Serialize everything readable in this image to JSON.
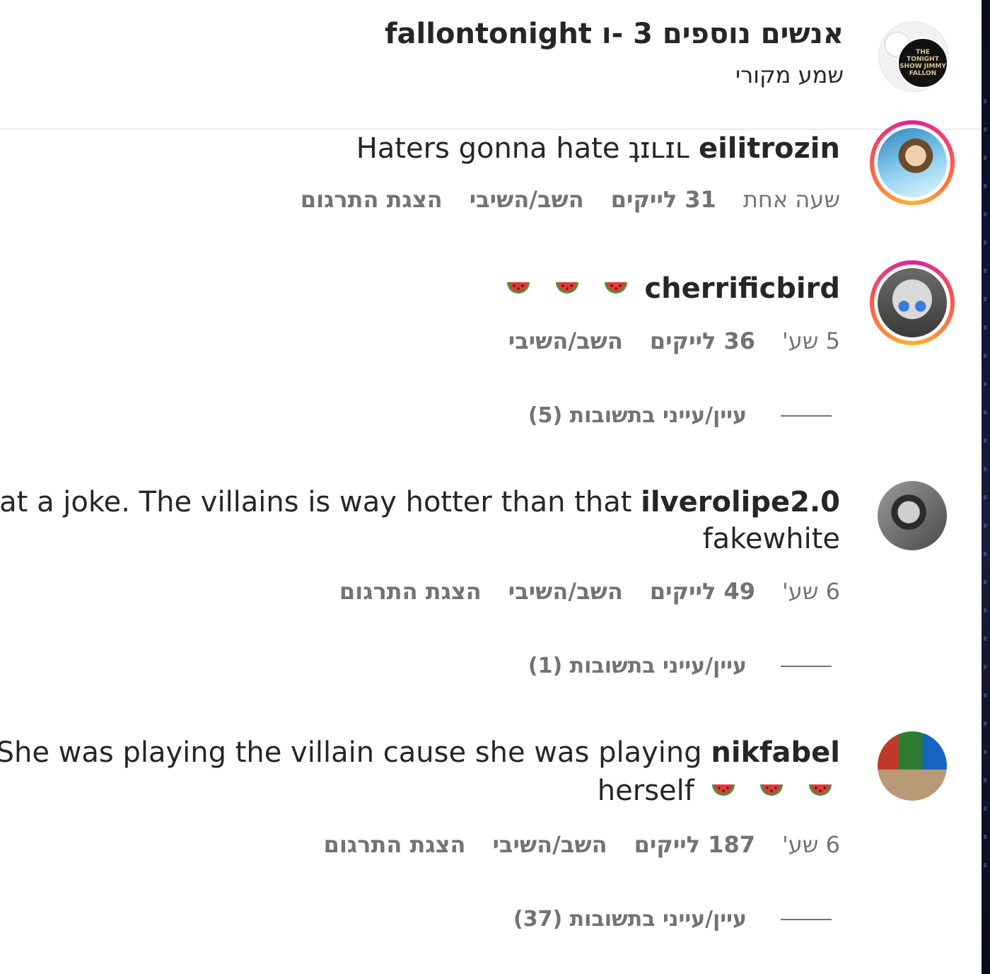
{
  "header": {
    "title": "אנשים נוספים 3 -ו fallontonight",
    "subtitle": "שמע מקורי",
    "logo_text": "THE TONIGHT SHOW JIMMY FALLON"
  },
  "comments": [
    {
      "username": "eilitrozin",
      "text": "Haters gonna hate ʇɪʟɪʟ",
      "time": "שעה אחת",
      "likes": "31 לייקים",
      "reply": "השב/השיבי",
      "translate": "הצגת התרגום",
      "avatar_colors": [
        "#4a9ec7",
        "#f1d0b0"
      ]
    },
    {
      "username": "cherrificbird",
      "text": "",
      "emoji": [
        "watermelon",
        "watermelon",
        "watermelon"
      ],
      "time": "5 שע'",
      "likes": "36 לייקים",
      "reply": "השב/השיבי",
      "view_replies": "עיין/עייני בתשובות (5)",
      "avatar_colors": [
        "#5b5b5b",
        "#3a7bd5"
      ]
    },
    {
      "username": "ilverolipe2.0",
      "text": "What a joke. The villains is way hotter than that",
      "text_line2": "fakewhite",
      "time": "6 שע'",
      "likes": "49 לייקים",
      "reply": "השב/השיבי",
      "translate": "הצגת התרגום",
      "view_replies": "עיין/עייני בתשובות (1)",
      "avatar_colors": [
        "#8a8a8a",
        "#2b2b2b"
      ]
    },
    {
      "username": "nikfabel",
      "text": "She was playing the villain cause she was playing",
      "text_line2": "herself",
      "emoji": [
        "watermelon",
        "watermelon",
        "watermelon"
      ],
      "time": "6 שע'",
      "likes": "187 לייקים",
      "reply": "השב/השיבי",
      "translate": "הצגת התרגום",
      "view_replies": "עיין/עייני בתשובות (37)",
      "avatar_colors": [
        "#7a5a3a",
        "#3a8a5a"
      ]
    }
  ],
  "colors": {
    "text": "#262626",
    "muted": "#737373",
    "ring_start": "#d6249f",
    "ring_end": "#fdb12e"
  }
}
